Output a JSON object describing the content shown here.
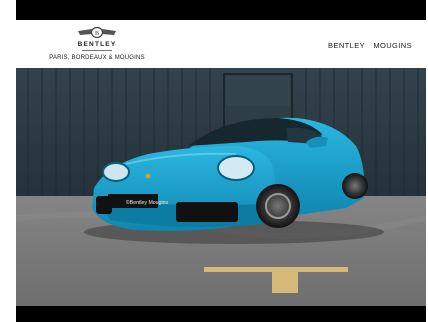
{
  "header": {
    "brand_word": "BENTLEY",
    "brand_locations": "PARIS, BORDEAUX & MOUGINS",
    "dealer_name": "BENTLEY MOUGINS",
    "dealer_name_parts": [
      "BENTLEY",
      "MOUGINS"
    ]
  },
  "photo": {
    "plate_text": "©Bentley Mougins",
    "car_color": "#14a3cf",
    "wall_color": "#2b3944",
    "ground_color": "#7d7d7d"
  }
}
